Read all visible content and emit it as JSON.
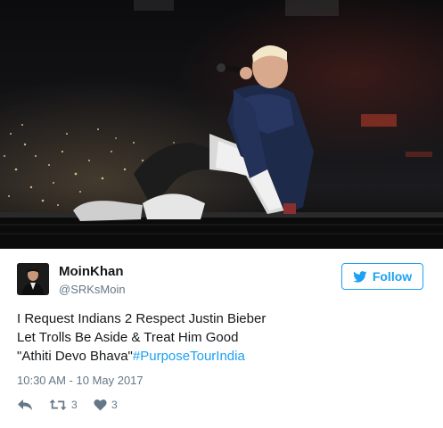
{
  "tweet": {
    "author_name": "MoinKhan",
    "author_handle": "@SRKsMoin",
    "follow_label": "Follow",
    "text_lines": [
      "I Request Indians 2 Respect Justin Bieber",
      "Let Trolls Be Aside & Treat Him Good"
    ],
    "text_last_line_prefix": "\"Athiti Devo Bhava\"",
    "hashtag": "#PurposeTourIndia",
    "timestamp": "10:30 AM - 10 May 2017",
    "retweet_count": "3",
    "like_count": "3"
  },
  "colors": {
    "accent": "#1da1f2",
    "secondary_text": "#657786",
    "primary_text": "#14171a"
  },
  "icons": {
    "follow": "twitter-bird-icon",
    "reply": "reply-icon",
    "retweet": "retweet-icon",
    "like": "heart-icon"
  }
}
